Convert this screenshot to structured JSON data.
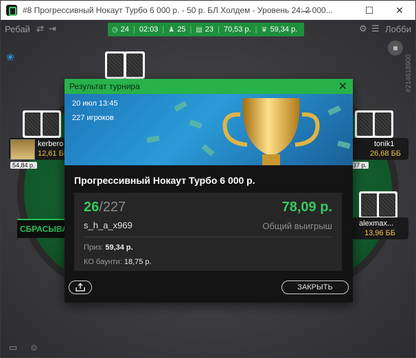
{
  "window": {
    "title": "#8 Прогрессивный Нокаут Турбо 6 000 р. - 50 р. БЛ Холдем - Уровень 24: 2 000...",
    "minimize": "—",
    "maximize": "☐",
    "close": "✕"
  },
  "topbar": {
    "rebuy_label": "Ребай",
    "lobby_label": "Лобби",
    "stats": {
      "level": "24",
      "time": "02:03",
      "players": "25",
      "avg_rank": "23",
      "avg_stack": "70,53 р.",
      "prize": "59,34 р."
    },
    "tournament_id": "#214618900"
  },
  "players": {
    "left": {
      "name": "kerbero",
      "stack": "12,61 ББ",
      "bet": "54,84 р."
    },
    "right_top": {
      "name": "tonik1",
      "stack": "26,68 ББ",
      "bet": "37 р."
    },
    "right_mid": {
      "name": "alexmax...",
      "stack": "13,96 ББ"
    }
  },
  "fold_badge": "СБРАСЫВА",
  "modal": {
    "title": "Результат турнира",
    "close_icon": "✕",
    "date": "20 июл 13:45",
    "players_count": "227 игроков",
    "tournament_name": "Прогрессивный Нокаут Турбо 6 000 р.",
    "place": "26",
    "place_separator": "/",
    "total_entries": "227",
    "username": "s_h_a_x969",
    "winnings": "78,09 р.",
    "winnings_label": "Общий выигрыш",
    "prize_label": "Приз:",
    "prize_value": "59,34 р.",
    "ko_label": "КО баунти:",
    "ko_value": "18,75 р.",
    "close_button": "ЗАКРЫТЬ"
  },
  "colors": {
    "accent_green": "#27b24a",
    "value_green": "#38c95e",
    "stack_yellow": "#f0c64a"
  }
}
